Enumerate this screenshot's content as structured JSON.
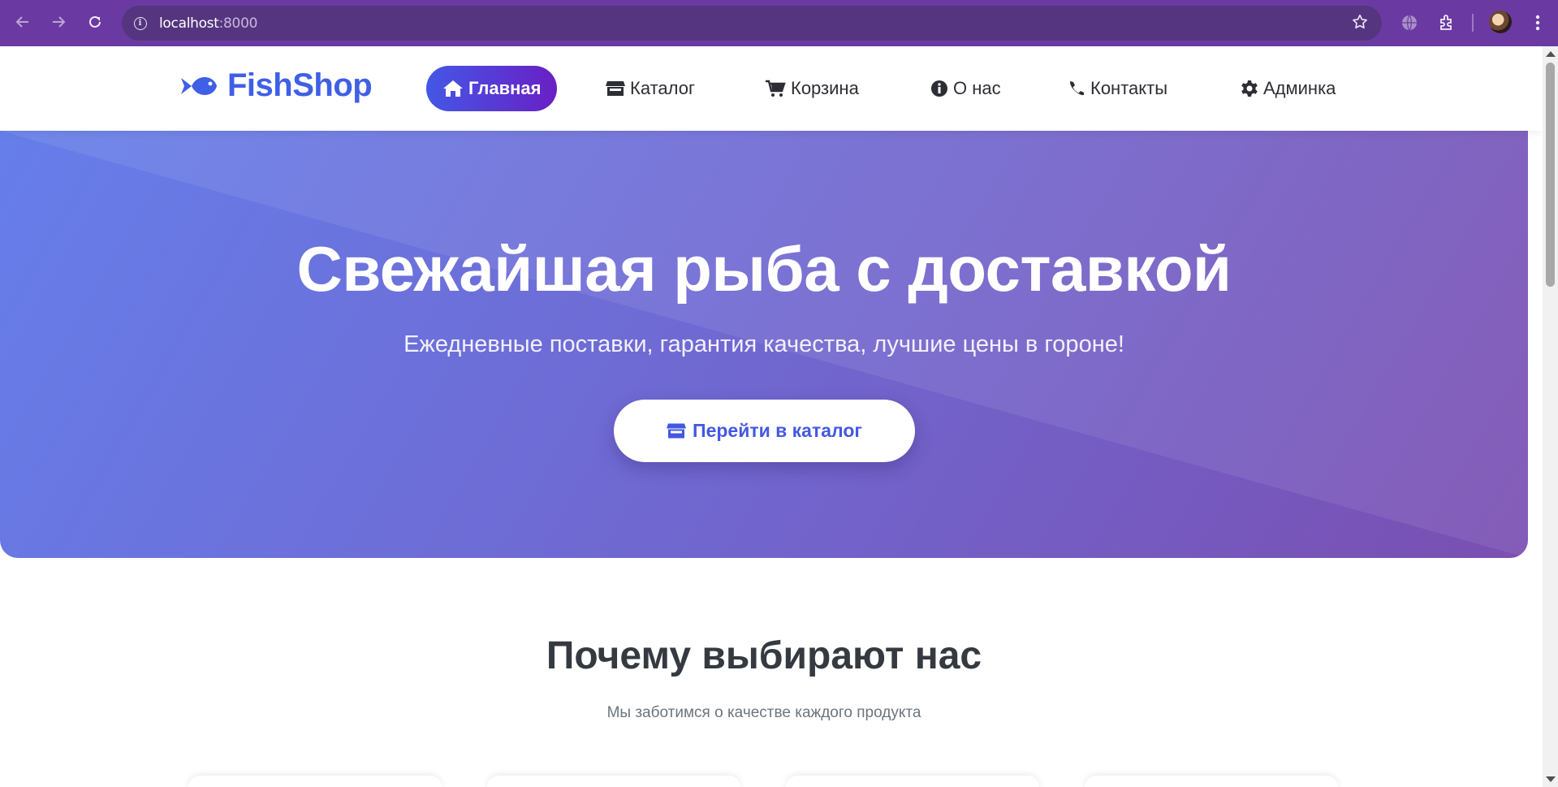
{
  "browser": {
    "url_host": "localhost",
    "url_port": ":8000",
    "icons": [
      "back-arrow-icon",
      "forward-arrow-icon",
      "reload-icon",
      "site-info-icon",
      "bookmark-star-icon",
      "globe-icon",
      "extensions-icon",
      "profile-avatar",
      "menu-kebab-icon"
    ]
  },
  "header": {
    "logo_text": "FishShop",
    "nav": [
      {
        "label": "Главная",
        "icon": "home-icon",
        "active": true
      },
      {
        "label": "Каталог",
        "icon": "store-icon",
        "active": false
      },
      {
        "label": "Корзина",
        "icon": "cart-icon",
        "active": false
      },
      {
        "label": "О нас",
        "icon": "info-icon",
        "active": false
      },
      {
        "label": "Контакты",
        "icon": "phone-icon",
        "active": false
      },
      {
        "label": "Админка",
        "icon": "gear-icon",
        "active": false
      }
    ]
  },
  "hero": {
    "title": "Свежайшая рыба с доставкой",
    "subtitle": "Ежедневные поставки, гарантия качества, лучшие цены в гороне!",
    "cta_label": "Перейти в каталог"
  },
  "features": {
    "title": "Почему выбирают нас",
    "subtitle": "Мы заботимся о качестве каждого продукта"
  },
  "colors": {
    "brand": "#3f5fe6",
    "hero_gradient_start": "#667eea",
    "hero_gradient_end": "#7a4fb2",
    "chrome": "#6a3aa2"
  }
}
